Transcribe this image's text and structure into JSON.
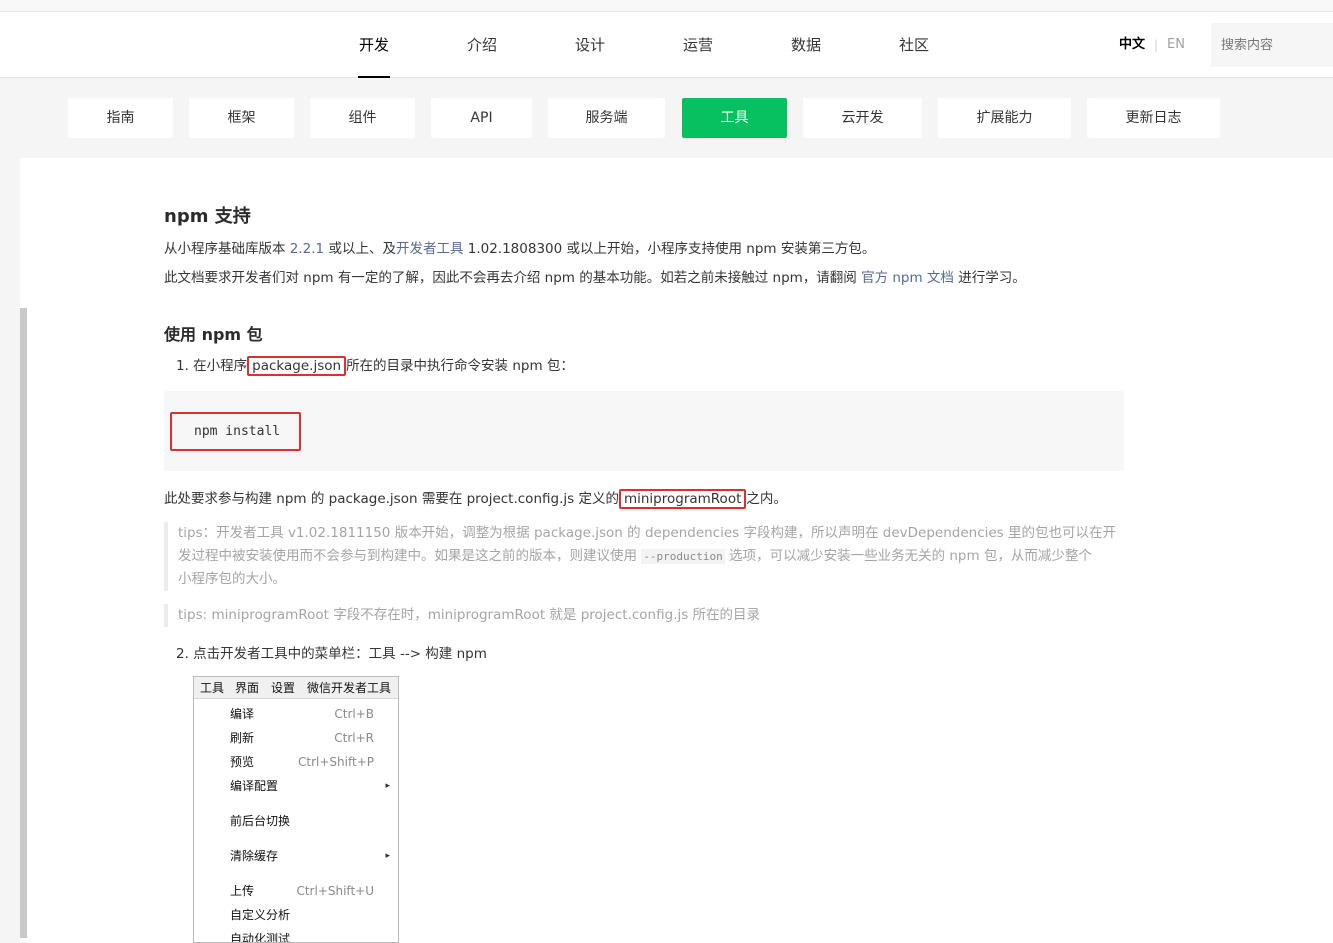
{
  "top_nav": {
    "items": [
      "开发",
      "介绍",
      "设计",
      "运营",
      "数据",
      "社区"
    ],
    "active": "开发"
  },
  "lang": {
    "zh": "中文",
    "separator": "|",
    "en": "EN"
  },
  "search": {
    "placeholder": "搜索内容"
  },
  "sub_nav": {
    "items": [
      "指南",
      "框架",
      "组件",
      "API",
      "服务端",
      "工具",
      "云开发",
      "扩展能力",
      "更新日志"
    ],
    "active": "工具"
  },
  "article": {
    "title": "npm 支持",
    "intro1": {
      "prefix": "从小程序基础库版本 ",
      "link1": "2.2.1",
      "middle": " 或以上、及",
      "link2": "开发者工具",
      "suffix": " 1.02.1808300 或以上开始，小程序支持使用 npm 安装第三方包。"
    },
    "intro2": {
      "prefix": "此文档要求开发者们对 npm 有一定的了解，因此不会再去介绍 npm 的基本功能。如若之前未接触过 npm，请翻阅 ",
      "link": "官方 npm 文档",
      "suffix": " 进行学习。"
    },
    "section_title": "使用 npm 包",
    "step1": {
      "prefix": "1. 在小程序",
      "highlight": "package.json",
      "suffix": "所在的目录中执行命令安装 npm 包："
    },
    "code": "npm install",
    "note": {
      "prefix": "此处要求参与构建 npm 的 package.json 需要在 project.config.js 定义的",
      "highlight": "miniprogramRoot",
      "suffix": "之内。"
    },
    "tip1": {
      "line1": "tips：开发者工具 v1.02.1811150 版本开始，调整为根据 package.json 的 dependencies 字段构建，所以声明在 devDependencies 里的包也可以在开",
      "line2_prefix": "发过程中被安装使用而不会参与到构建中。如果是这之前的版本，则建议使用 ",
      "line2_code": "--production",
      "line2_suffix": " 选项，可以减少安装一些业务无关的 npm 包，从而减少整个",
      "line3": "小程序包的大小。"
    },
    "tip2": "tips: miniprogramRoot 字段不存在时，miniprogramRoot 就是 project.config.js 所在的目录",
    "step2": "2. 点击开发者工具中的菜单栏：工具 --> 构建 npm"
  },
  "menu_screenshot": {
    "menubar": [
      "工具",
      "界面",
      "设置",
      "微信开发者工具"
    ],
    "items": [
      {
        "label": "编译",
        "shortcut": "Ctrl+B",
        "submenu": false
      },
      {
        "label": "刷新",
        "shortcut": "Ctrl+R",
        "submenu": false
      },
      {
        "label": "预览",
        "shortcut": "Ctrl+Shift+P",
        "submenu": false
      },
      {
        "label": "编译配置",
        "shortcut": "",
        "submenu": true
      },
      {
        "label": "前后台切换",
        "shortcut": "",
        "submenu": false
      },
      {
        "label": "清除缓存",
        "shortcut": "",
        "submenu": true
      },
      {
        "label": "上传",
        "shortcut": "Ctrl+Shift+U",
        "submenu": false
      },
      {
        "label": "自定义分析",
        "shortcut": "",
        "submenu": false
      },
      {
        "label": "自动化测试",
        "shortcut": "",
        "submenu": false
      }
    ]
  },
  "icons": {
    "submenu_arrow": "▸"
  },
  "colors": {
    "accent_green": "#07c160",
    "link": "#576b95",
    "highlight_red": "#e12d2d"
  }
}
